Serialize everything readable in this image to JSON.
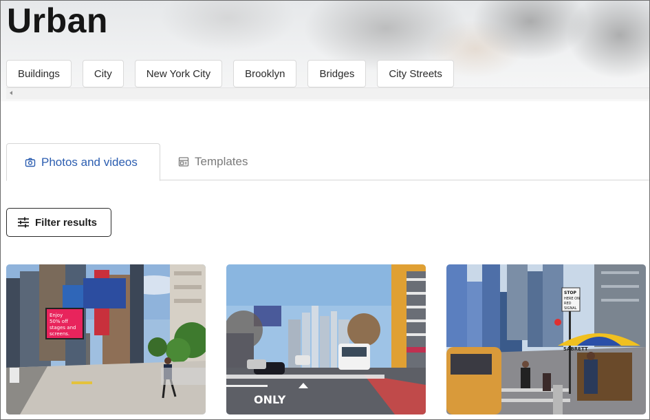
{
  "hero": {
    "title": "Urban"
  },
  "related_tags": [
    "Buildings",
    "City",
    "New York City",
    "Brooklyn",
    "Bridges",
    "City Streets"
  ],
  "tabs": {
    "photos": {
      "label": "Photos and videos",
      "icon": "camera-icon",
      "active": true
    },
    "templates": {
      "label": "Templates",
      "icon": "template-icon",
      "active": false
    }
  },
  "filter": {
    "label": "Filter results",
    "icon": "sliders-icon"
  },
  "results": [
    {
      "image": "street-with-billboard-photo",
      "billboard_text": [
        "Enjoy",
        "50% off",
        "stages and",
        "screens."
      ]
    },
    {
      "image": "avenue-with-bus-photo",
      "road_text": "ONLY"
    },
    {
      "image": "city-crosswalk-with-umbrella-photo",
      "sign_text": [
        "STOP",
        "HERE ON",
        "RED",
        "SIGNAL"
      ],
      "umbrella_text": "SABRETT"
    }
  ],
  "colors": {
    "accent": "#2b5db0",
    "border": "#d6d6d6"
  }
}
